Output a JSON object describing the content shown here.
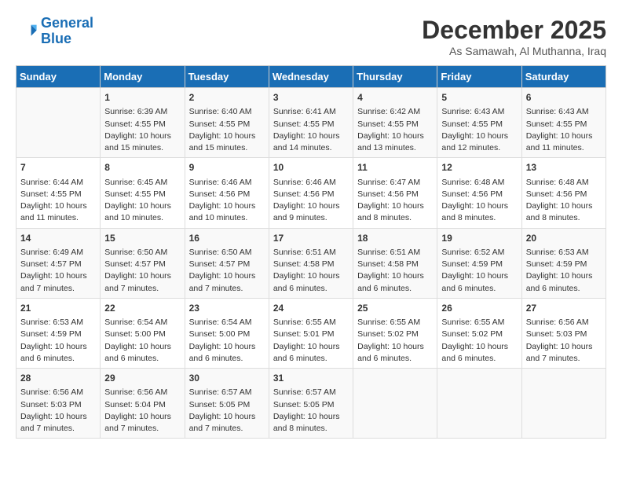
{
  "logo": {
    "line1": "General",
    "line2": "Blue"
  },
  "title": "December 2025",
  "location": "As Samawah, Al Muthanna, Iraq",
  "days_of_week": [
    "Sunday",
    "Monday",
    "Tuesday",
    "Wednesday",
    "Thursday",
    "Friday",
    "Saturday"
  ],
  "weeks": [
    [
      {
        "day": "",
        "content": ""
      },
      {
        "day": "1",
        "content": "Sunrise: 6:39 AM\nSunset: 4:55 PM\nDaylight: 10 hours\nand 15 minutes."
      },
      {
        "day": "2",
        "content": "Sunrise: 6:40 AM\nSunset: 4:55 PM\nDaylight: 10 hours\nand 15 minutes."
      },
      {
        "day": "3",
        "content": "Sunrise: 6:41 AM\nSunset: 4:55 PM\nDaylight: 10 hours\nand 14 minutes."
      },
      {
        "day": "4",
        "content": "Sunrise: 6:42 AM\nSunset: 4:55 PM\nDaylight: 10 hours\nand 13 minutes."
      },
      {
        "day": "5",
        "content": "Sunrise: 6:43 AM\nSunset: 4:55 PM\nDaylight: 10 hours\nand 12 minutes."
      },
      {
        "day": "6",
        "content": "Sunrise: 6:43 AM\nSunset: 4:55 PM\nDaylight: 10 hours\nand 11 minutes."
      }
    ],
    [
      {
        "day": "7",
        "content": "Sunrise: 6:44 AM\nSunset: 4:55 PM\nDaylight: 10 hours\nand 11 minutes."
      },
      {
        "day": "8",
        "content": "Sunrise: 6:45 AM\nSunset: 4:55 PM\nDaylight: 10 hours\nand 10 minutes."
      },
      {
        "day": "9",
        "content": "Sunrise: 6:46 AM\nSunset: 4:56 PM\nDaylight: 10 hours\nand 10 minutes."
      },
      {
        "day": "10",
        "content": "Sunrise: 6:46 AM\nSunset: 4:56 PM\nDaylight: 10 hours\nand 9 minutes."
      },
      {
        "day": "11",
        "content": "Sunrise: 6:47 AM\nSunset: 4:56 PM\nDaylight: 10 hours\nand 8 minutes."
      },
      {
        "day": "12",
        "content": "Sunrise: 6:48 AM\nSunset: 4:56 PM\nDaylight: 10 hours\nand 8 minutes."
      },
      {
        "day": "13",
        "content": "Sunrise: 6:48 AM\nSunset: 4:56 PM\nDaylight: 10 hours\nand 8 minutes."
      }
    ],
    [
      {
        "day": "14",
        "content": "Sunrise: 6:49 AM\nSunset: 4:57 PM\nDaylight: 10 hours\nand 7 minutes."
      },
      {
        "day": "15",
        "content": "Sunrise: 6:50 AM\nSunset: 4:57 PM\nDaylight: 10 hours\nand 7 minutes."
      },
      {
        "day": "16",
        "content": "Sunrise: 6:50 AM\nSunset: 4:57 PM\nDaylight: 10 hours\nand 7 minutes."
      },
      {
        "day": "17",
        "content": "Sunrise: 6:51 AM\nSunset: 4:58 PM\nDaylight: 10 hours\nand 6 minutes."
      },
      {
        "day": "18",
        "content": "Sunrise: 6:51 AM\nSunset: 4:58 PM\nDaylight: 10 hours\nand 6 minutes."
      },
      {
        "day": "19",
        "content": "Sunrise: 6:52 AM\nSunset: 4:59 PM\nDaylight: 10 hours\nand 6 minutes."
      },
      {
        "day": "20",
        "content": "Sunrise: 6:53 AM\nSunset: 4:59 PM\nDaylight: 10 hours\nand 6 minutes."
      }
    ],
    [
      {
        "day": "21",
        "content": "Sunrise: 6:53 AM\nSunset: 4:59 PM\nDaylight: 10 hours\nand 6 minutes."
      },
      {
        "day": "22",
        "content": "Sunrise: 6:54 AM\nSunset: 5:00 PM\nDaylight: 10 hours\nand 6 minutes."
      },
      {
        "day": "23",
        "content": "Sunrise: 6:54 AM\nSunset: 5:00 PM\nDaylight: 10 hours\nand 6 minutes."
      },
      {
        "day": "24",
        "content": "Sunrise: 6:55 AM\nSunset: 5:01 PM\nDaylight: 10 hours\nand 6 minutes."
      },
      {
        "day": "25",
        "content": "Sunrise: 6:55 AM\nSunset: 5:02 PM\nDaylight: 10 hours\nand 6 minutes."
      },
      {
        "day": "26",
        "content": "Sunrise: 6:55 AM\nSunset: 5:02 PM\nDaylight: 10 hours\nand 6 minutes."
      },
      {
        "day": "27",
        "content": "Sunrise: 6:56 AM\nSunset: 5:03 PM\nDaylight: 10 hours\nand 7 minutes."
      }
    ],
    [
      {
        "day": "28",
        "content": "Sunrise: 6:56 AM\nSunset: 5:03 PM\nDaylight: 10 hours\nand 7 minutes."
      },
      {
        "day": "29",
        "content": "Sunrise: 6:56 AM\nSunset: 5:04 PM\nDaylight: 10 hours\nand 7 minutes."
      },
      {
        "day": "30",
        "content": "Sunrise: 6:57 AM\nSunset: 5:05 PM\nDaylight: 10 hours\nand 7 minutes."
      },
      {
        "day": "31",
        "content": "Sunrise: 6:57 AM\nSunset: 5:05 PM\nDaylight: 10 hours\nand 8 minutes."
      },
      {
        "day": "",
        "content": ""
      },
      {
        "day": "",
        "content": ""
      },
      {
        "day": "",
        "content": ""
      }
    ]
  ]
}
